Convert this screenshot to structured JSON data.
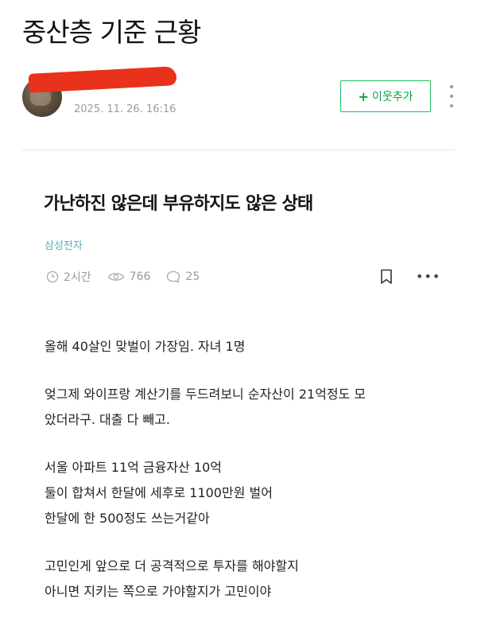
{
  "header": {
    "page_title": "중산층 기준 근황"
  },
  "author": {
    "name": "",
    "date": "2025. 11. 26. 16:16",
    "follow_label": "이웃추가"
  },
  "post": {
    "title": "가난하진 않은데 부유하지도 않은 상태",
    "category": "삼성전자",
    "meta": {
      "time": "2시간",
      "views": "766",
      "comments": "25"
    },
    "body": {
      "p1": [
        "올해 40살인 맞벌이 가장임. 자녀 1명"
      ],
      "p2": [
        "엊그제 와이프랑 계산기를 두드려보니 순자산이 21억정도 모",
        "았더라구. 대출 다 빼고."
      ],
      "p3": [
        "서울 아파트 11억 금융자산 10억",
        "둘이 합쳐서 한달에 세후로 1100만원 벌어",
        "한달에 한 500정도 쓰는거같아"
      ],
      "p4": [
        "고민인게 앞으로 더 공격적으로 투자를 해야할지",
        "아니면 지키는 쪽으로 가야할지가 고민이야"
      ]
    }
  },
  "colors": {
    "follow_accent": "#19c15d",
    "category": "#5aa9b8",
    "redaction": "#e8321b"
  },
  "icons": {
    "clock": "clock-icon",
    "views": "eye-icon",
    "comments": "comment-icon",
    "bookmark": "bookmark-icon",
    "more": "more-horizontal-icon",
    "kebab": "more-vertical-icon"
  }
}
